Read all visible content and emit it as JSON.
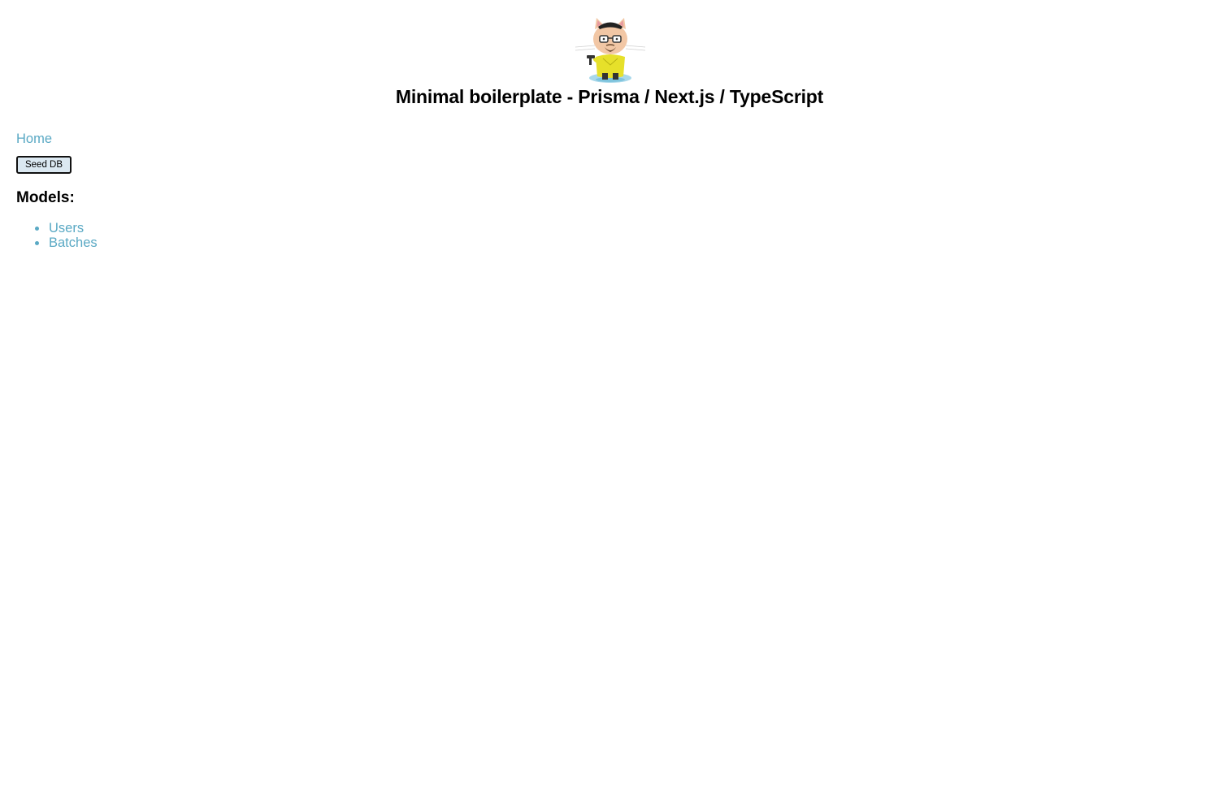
{
  "header": {
    "title": "Minimal boilerplate - Prisma / Next.js / TypeScript",
    "logo": "octocat-heisenberg-logo"
  },
  "nav": {
    "home_label": "Home"
  },
  "actions": {
    "seed_label": "Seed DB"
  },
  "models": {
    "heading": "Models:",
    "items": [
      {
        "label": "Users"
      },
      {
        "label": "Batches"
      }
    ]
  },
  "colors": {
    "link": "#5aa9c4",
    "button_bg": "#dbe8f1",
    "text": "#000000",
    "background": "#ffffff"
  }
}
